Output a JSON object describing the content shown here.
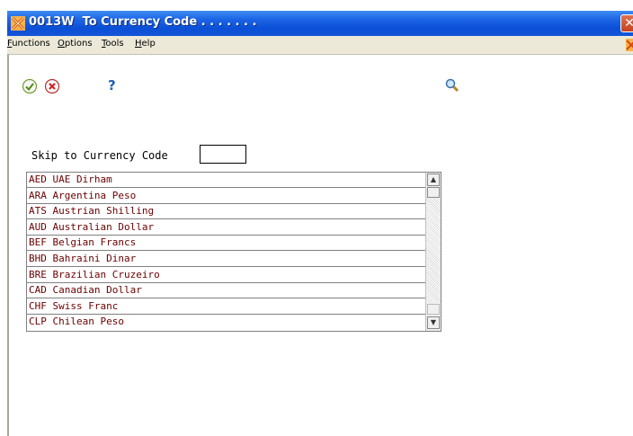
{
  "window": {
    "title": "0013W  To Currency Code . . . . . . .",
    "close_icon": "close-icon",
    "app_icon": "jde-app-icon"
  },
  "menubar": {
    "items": [
      {
        "label_first": "F",
        "label_rest": "unctions"
      },
      {
        "label_first": "O",
        "label_rest": "ptions"
      },
      {
        "label_first": "T",
        "label_rest": "ools"
      },
      {
        "label_first": "H",
        "label_rest": "elp"
      }
    ]
  },
  "toolbar": {
    "ok_icon": "checkmark-icon",
    "cancel_icon": "cancel-x-icon",
    "help_label": "?",
    "find_icon": "magnifier-icon"
  },
  "form": {
    "skip_label": "Skip to Currency Code",
    "skip_value": ""
  },
  "list": {
    "rows": [
      "AED UAE Dirham",
      "ARA Argentina Peso",
      "ATS Austrian Shilling",
      "AUD Australian Dollar",
      "BEF Belgian Francs",
      "BHD Bahraini Dinar",
      "BRE Brazilian Cruzeiro",
      "CAD Canadian Dollar",
      "CHF Swiss Franc",
      "CLP Chilean Peso"
    ]
  },
  "colors": {
    "title_bar": "#1c64e4",
    "menubar": "#ece9d8",
    "row_text": "#6b0000"
  }
}
